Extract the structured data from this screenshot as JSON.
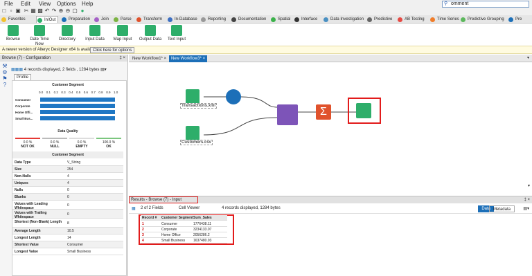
{
  "menu": {
    "items": [
      "File",
      "Edit",
      "View",
      "Options",
      "Help"
    ],
    "search_value": "omment"
  },
  "category_tabs": [
    {
      "label": "Favorites",
      "color": "#f2c12e"
    },
    {
      "label": "In/Out",
      "color": "#2eae6a"
    },
    {
      "label": "Preparation",
      "color": "#1c6fb8"
    },
    {
      "label": "Join",
      "color": "#a561c7"
    },
    {
      "label": "Parse",
      "color": "#7cb342"
    },
    {
      "label": "Transform",
      "color": "#e0522c"
    },
    {
      "label": "In-Database",
      "color": "#3d6fc2"
    },
    {
      "label": "Reporting",
      "color": "#999999"
    },
    {
      "label": "Documentation",
      "color": "#444444"
    },
    {
      "label": "Spatial",
      "color": "#3bb24a"
    },
    {
      "label": "Interface",
      "color": "#333333"
    },
    {
      "label": "Data Investigation",
      "color": "#4a90c2"
    },
    {
      "label": "Predictive",
      "color": "#666666"
    },
    {
      "label": "AB Testing",
      "color": "#e64a44"
    },
    {
      "label": "Time Series",
      "color": "#f07d2a"
    },
    {
      "label": "Predictive Grouping",
      "color": "#5cb85c"
    },
    {
      "label": "Pre",
      "color": "#1c6fb8"
    }
  ],
  "tools": [
    "Browse",
    "Date Time Now",
    "Directory",
    "Input Data",
    "Map Input",
    "Output Data",
    "Text Input"
  ],
  "notice": {
    "text": "A newer version of Alteryx Designer x64 is available.",
    "button": "Click here for options"
  },
  "left_panel": {
    "title": "Browse (7) - Configuration",
    "header": "4 records displayed, 2 fields , 1284 bytes",
    "tab": "Profile",
    "chart_title": "Customer Segment",
    "ticks": [
      "0.0",
      "0.1",
      "0.2",
      "0.3",
      "0.4",
      "0.5",
      "0.6",
      "0.7",
      "0.8",
      "0.9",
      "1.0"
    ],
    "categories": [
      "Consumer",
      "Corporate",
      "Home Offi...",
      "Small Bus..."
    ],
    "dq_title": "Data Quality",
    "dq": [
      {
        "pct": "0.0 %",
        "label": "NOT OK"
      },
      {
        "pct": "0.0 %",
        "label": "NULL"
      },
      {
        "pct": "0.0 %",
        "label": "EMPTY"
      },
      {
        "pct": "100.0 %",
        "label": "OK"
      }
    ],
    "field_header": "Customer Segment",
    "stats": [
      {
        "k": "Data Type",
        "v": "V_String"
      },
      {
        "k": "Size",
        "v": "254"
      },
      {
        "k": "Non-Nulls",
        "v": "4"
      },
      {
        "k": "Uniques",
        "v": "4"
      },
      {
        "k": "Nulls",
        "v": "0"
      },
      {
        "k": "Blanks",
        "v": "0"
      },
      {
        "k": "Values with Leading Whitespace",
        "v": "0"
      },
      {
        "k": "Values with Trailing Whitespace",
        "v": "0"
      },
      {
        "k": "Shortest (Non-Blank) Length",
        "v": "8"
      },
      {
        "k": "Average Length",
        "v": "10.5"
      },
      {
        "k": "Longest Length",
        "v": "14"
      },
      {
        "k": "Shortest Value",
        "v": "Consumer"
      },
      {
        "k": "Longest Value",
        "v": "Small Business"
      }
    ]
  },
  "canvas": {
    "tabs": [
      "New Workflow1*",
      "New Workflow3*"
    ],
    "labels": {
      "transactions": "Transactions.xml",
      "customers": "Customers.csv"
    }
  },
  "results": {
    "title": "Results - Browse (7) - Input",
    "fields_dropdown": "2 of 2 Fields",
    "viewer": "Cell Viewer",
    "status": "4 records displayed, 1284 bytes",
    "toggle": [
      "Data",
      "Metadata"
    ],
    "columns": [
      "Record #",
      "Customer Segment",
      "Sum_Sales"
    ],
    "rows": [
      [
        "1",
        "Consumer",
        "1776438.11"
      ],
      [
        "2",
        "Corporate",
        "3234133.07"
      ],
      [
        "3",
        "Home Office",
        "2056286.2"
      ],
      [
        "4",
        "Small Business",
        "1637480.93"
      ]
    ]
  }
}
